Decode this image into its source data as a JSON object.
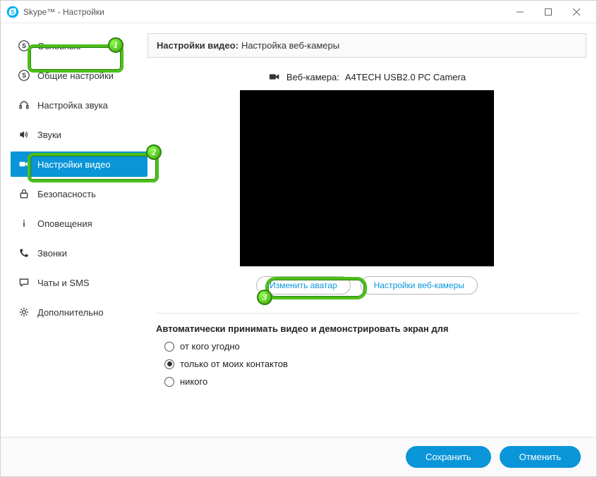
{
  "window": {
    "title": "Skype™ - Настройки"
  },
  "sidebar": {
    "items": [
      {
        "label": "Основные"
      },
      {
        "label": "Общие настройки"
      },
      {
        "label": "Настройка звука"
      },
      {
        "label": "Звуки"
      },
      {
        "label": "Настройки видео"
      },
      {
        "label": "Безопасность"
      },
      {
        "label": "Оповещения"
      },
      {
        "label": "Звонки"
      },
      {
        "label": "Чаты и SMS"
      },
      {
        "label": "Дополнительно"
      }
    ]
  },
  "header": {
    "bold": "Настройки видео:",
    "rest": "Настройка веб-камеры"
  },
  "camera": {
    "label": "Веб-камера:",
    "name": "A4TECH USB2.0 PC Camera"
  },
  "buttons": {
    "change_avatar": "Изменить аватар",
    "webcam_settings": "Настройки веб-камеры",
    "save": "Сохранить",
    "cancel": "Отменить"
  },
  "autoAccept": {
    "title": "Автоматически принимать видео и демонстрировать экран для",
    "options": [
      {
        "label": "от кого угодно",
        "checked": false
      },
      {
        "label": "только от моих контактов",
        "checked": true
      },
      {
        "label": "никого",
        "checked": false
      }
    ]
  },
  "annotations": {
    "1": "1",
    "2": "2",
    "3": "3"
  }
}
